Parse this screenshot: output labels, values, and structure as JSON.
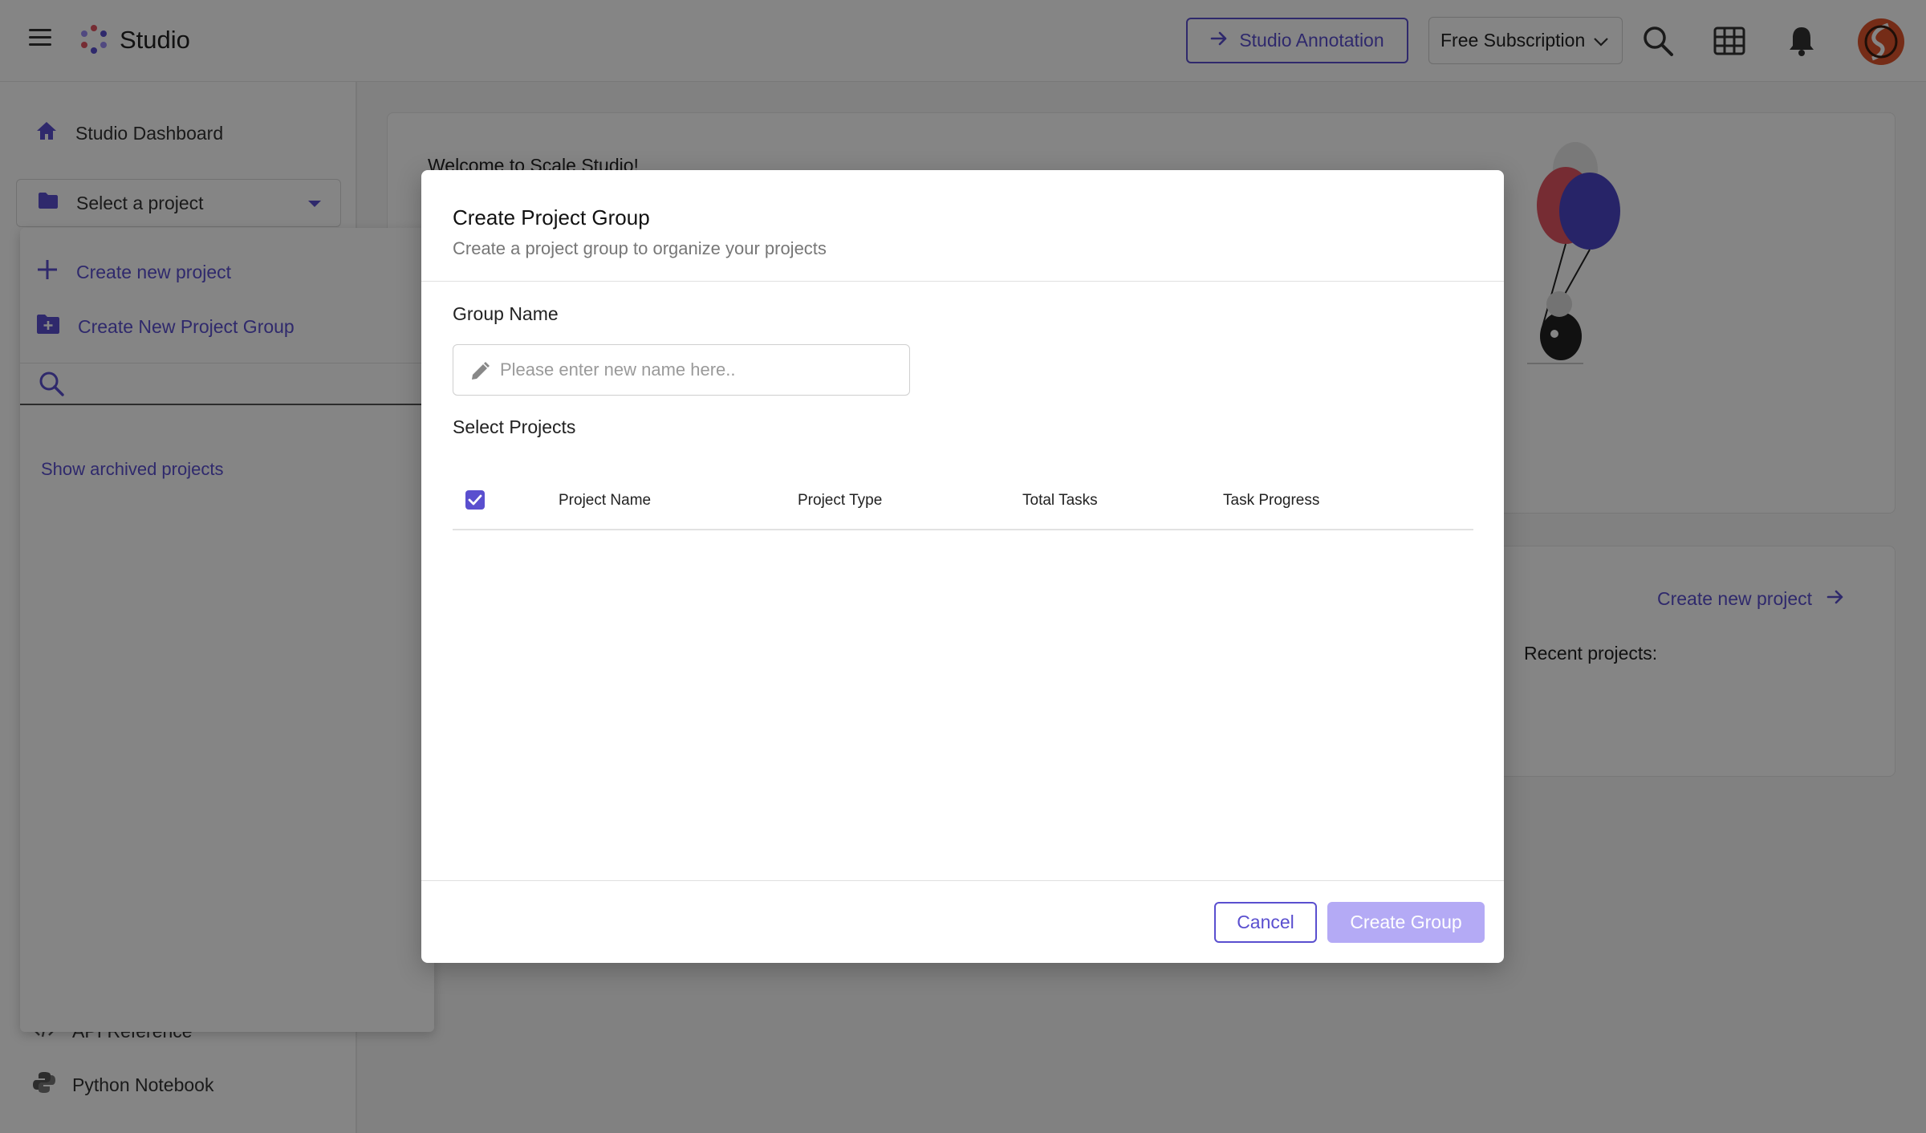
{
  "header": {
    "brand": "Studio",
    "annotation_button": "Studio Annotation",
    "subscription": "Free Subscription"
  },
  "sidebar": {
    "dashboard": "Studio Dashboard",
    "project_select": "Select a project",
    "bottom_items": [
      {
        "label": "API Reference",
        "icon": "code-icon"
      },
      {
        "label": "Python Notebook",
        "icon": "python-icon"
      }
    ]
  },
  "dropdown": {
    "create_project": "Create new project",
    "create_group": "Create New Project Group",
    "show_archived": "Show archived projects"
  },
  "main": {
    "welcome": "Welcome to Scale Studio!",
    "create_link": "Create new project",
    "recent": "Recent projects:"
  },
  "modal": {
    "title": "Create Project Group",
    "subtitle": "Create a project group to organize your projects",
    "group_name_label": "Group Name",
    "group_name_placeholder": "Please enter new name here..",
    "group_name_value": "",
    "select_projects_label": "Select Projects",
    "columns": [
      "Project Name",
      "Project Type",
      "Total Tasks",
      "Task Progress"
    ],
    "select_all_checked": true,
    "rows": [],
    "cancel": "Cancel",
    "create": "Create Group"
  },
  "colors": {
    "accent": "#5a4fcf",
    "accent_disabled": "#b4aaf5",
    "overlay": "rgba(0,0,0,0.48)"
  }
}
